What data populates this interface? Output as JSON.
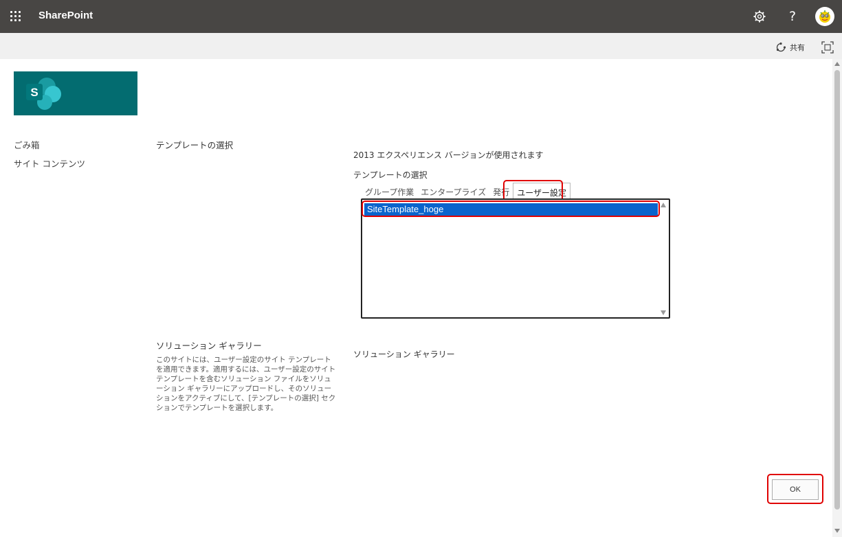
{
  "suite_bar": {
    "title": "SharePoint",
    "help_symbol": "?"
  },
  "command_bar": {
    "share_label": "共有"
  },
  "site": {
    "logo_letter": "S"
  },
  "nav": {
    "items": [
      "ごみ箱",
      "サイト コンテンツ"
    ]
  },
  "template_section": {
    "title": "テンプレートの選択",
    "experience_note": "2013 エクスペリエンス バージョンが使用されます",
    "label": "テンプレートの選択",
    "tabs": [
      "グループ作業",
      "エンタープライズ",
      "発行",
      "ユーザー設定"
    ],
    "active_tab": "ユーザー設定",
    "list_items": [
      "SiteTemplate_hoge"
    ]
  },
  "solution_section": {
    "title": "ソリューション ギャラリー",
    "description": "このサイトには、ユーザー設定のサイト テンプレートを適用できます。適用するには、ユーザー設定のサイト テンプレートを含むソリューション ファイルをソリューション ギャラリーにアップロードし、そのソリューションをアクティブにして、[テンプレートの選択] セクションでテンプレートを選択します。",
    "link": "ソリューション ギャラリー"
  },
  "actions": {
    "ok_label": "OK"
  },
  "colors": {
    "suite_bar": "#484644",
    "site_logo": "#036c70",
    "selection": "#0a64cc",
    "highlight": "#e00000"
  },
  "icons": [
    "waffle-icon",
    "gear-icon",
    "help-icon",
    "avatar",
    "share-icon",
    "focus-mode-icon"
  ]
}
